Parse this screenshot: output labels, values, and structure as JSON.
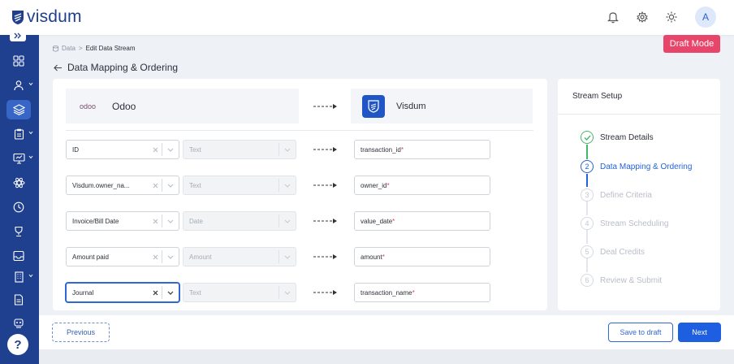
{
  "header": {
    "brand": "visdum",
    "avatar_initial": "A"
  },
  "breadcrumb": {
    "root": "Data",
    "separator": ">",
    "current": "Edit Data Stream"
  },
  "page": {
    "title": "Data Mapping & Ordering",
    "badge": "Draft Mode"
  },
  "mapping": {
    "source_name": "Odoo",
    "source_logo": "odoo",
    "destination_name": "Visdum",
    "rows": [
      {
        "field": "ID",
        "type": "Text",
        "target": "transaction_id",
        "required_mark": "*"
      },
      {
        "field": "Visdum.owner_na...",
        "type": "Text",
        "target": "owner_id",
        "required_mark": "*"
      },
      {
        "field": "Invoice/Bill Date",
        "type": "Date",
        "target": "value_date",
        "required_mark": "*"
      },
      {
        "field": "Amount paid",
        "type": "Amount",
        "target": "amount",
        "required_mark": "*"
      },
      {
        "field": "Journal",
        "type": "Text",
        "target": "transaction_name",
        "required_mark": "*"
      }
    ]
  },
  "setup": {
    "title": "Stream Setup",
    "steps": [
      {
        "num": "1",
        "label": "Stream Details",
        "state": "done"
      },
      {
        "num": "2",
        "label": "Data Mapping & Ordering",
        "state": "current"
      },
      {
        "num": "3",
        "label": "Define Criteria",
        "state": "pending"
      },
      {
        "num": "4",
        "label": "Stream Scheduling",
        "state": "pending"
      },
      {
        "num": "5",
        "label": "Deal Credits",
        "state": "pending"
      },
      {
        "num": "6",
        "label": "Review & Submit",
        "state": "pending"
      }
    ]
  },
  "footer": {
    "previous": "Previous",
    "save_draft": "Save to draft",
    "next": "Next"
  },
  "sidebar": {
    "help": "?"
  },
  "colors": {
    "brand": "#1f3f8f",
    "accent": "#1d5fe0",
    "draft": "#e8456a",
    "success": "#43b86c",
    "required": "#e23b5a"
  }
}
